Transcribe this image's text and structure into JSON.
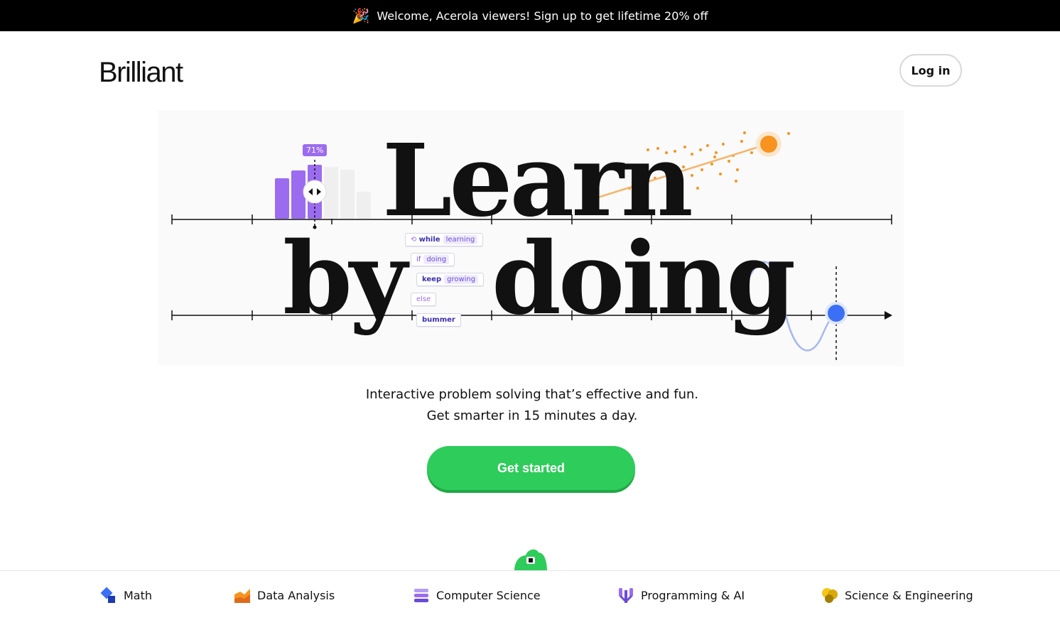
{
  "banner": {
    "icon": "party-popper-icon",
    "text": "Welcome, Acerola viewers! Sign up to get lifetime 20% off"
  },
  "header": {
    "logo": "Brilliant",
    "login_label": "Log in"
  },
  "hero": {
    "headline_line1": "Learn",
    "headline_line2a": "by",
    "headline_line2b": "doing",
    "slider_percent": "71%",
    "code_blocks": {
      "while": "while",
      "learning": "learning",
      "if": "if",
      "doing": "doing",
      "keep": "keep",
      "growing": "growing",
      "else": "else",
      "bummer": "bummer"
    }
  },
  "tagline": {
    "line1": "Interactive problem solving that’s effective and fun.",
    "line2": "Get smarter in 15 minutes a day."
  },
  "cta": {
    "label": "Get started",
    "color": "#2ecc5a"
  },
  "categories": [
    {
      "label": "Math",
      "icon": "math-icon"
    },
    {
      "label": "Data Analysis",
      "icon": "data-analysis-icon"
    },
    {
      "label": "Computer Science",
      "icon": "computer-science-icon"
    },
    {
      "label": "Programming & AI",
      "icon": "programming-ai-icon"
    },
    {
      "label": "Science & Engineering",
      "icon": "science-engineering-icon"
    }
  ],
  "colors": {
    "purple": "#9b6cf0",
    "orange": "#f7931e",
    "blue": "#3b6ff5",
    "green": "#2ecc5a"
  }
}
